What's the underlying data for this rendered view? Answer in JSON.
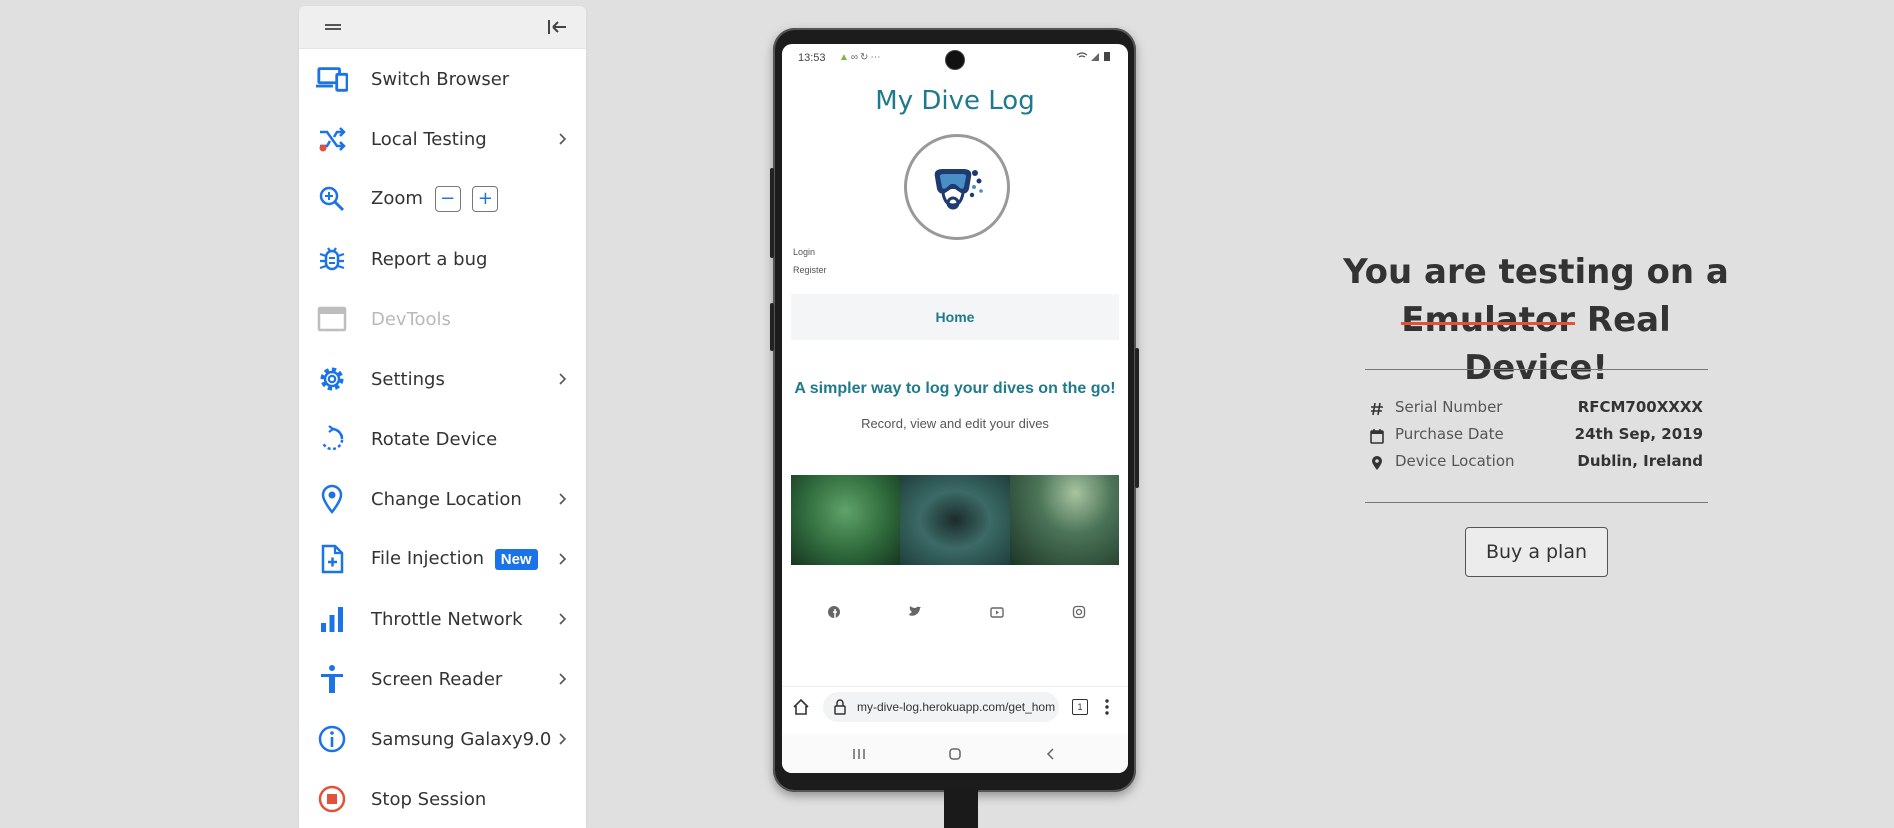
{
  "sidebar": {
    "items": [
      {
        "label": "Switch Browser",
        "icon": "devices-icon"
      },
      {
        "label": "Local Testing",
        "icon": "shuffle-icon"
      },
      {
        "label": "Zoom",
        "icon": "zoom-in-icon",
        "zoom_out": "−",
        "zoom_in": "+"
      },
      {
        "label": "Report a bug",
        "icon": "bug-icon"
      },
      {
        "label": "DevTools",
        "icon": "window-icon"
      },
      {
        "label": "Settings",
        "icon": "gear-icon"
      },
      {
        "label": "Rotate Device",
        "icon": "rotate-icon"
      },
      {
        "label": "Change Location",
        "icon": "location-pin-icon"
      },
      {
        "label": "File Injection",
        "icon": "file-add-icon",
        "badge": "New"
      },
      {
        "label": "Throttle Network",
        "icon": "signal-bars-icon"
      },
      {
        "label": "Screen Reader",
        "icon": "accessibility-icon"
      },
      {
        "label": "Samsung Galaxy9.0",
        "icon": "info-icon"
      },
      {
        "label": "Stop Session",
        "icon": "stop-icon"
      }
    ]
  },
  "phone": {
    "status_time": "13:53",
    "status_extras": "⋯",
    "app_title": "My Dive Log",
    "login": "Login",
    "register": "Register",
    "home_tab": "Home",
    "tagline": "A simpler way to log your dives on the go!",
    "subline": "Record, view and edit your dives",
    "url": "my-dive-log.herokuapp.com/get_hom",
    "tab_count": "1"
  },
  "info": {
    "title_prefix": "You are testing on a",
    "struck_word": "Emulator",
    "title_suffix": "Real Device!",
    "specs": [
      {
        "key": "Serial Number",
        "value": "RFCM700XXXX",
        "icon": "hash-icon"
      },
      {
        "key": "Purchase Date",
        "value": "24th Sep, 2019",
        "icon": "calendar-icon"
      },
      {
        "key": "Device Location",
        "value": "Dublin, Ireland",
        "icon": "location-pin-icon"
      }
    ],
    "buy_button": "Buy a plan"
  },
  "colors": {
    "accent": "#1a73e8",
    "teal": "#1f7a8c",
    "danger": "#e0533a"
  }
}
